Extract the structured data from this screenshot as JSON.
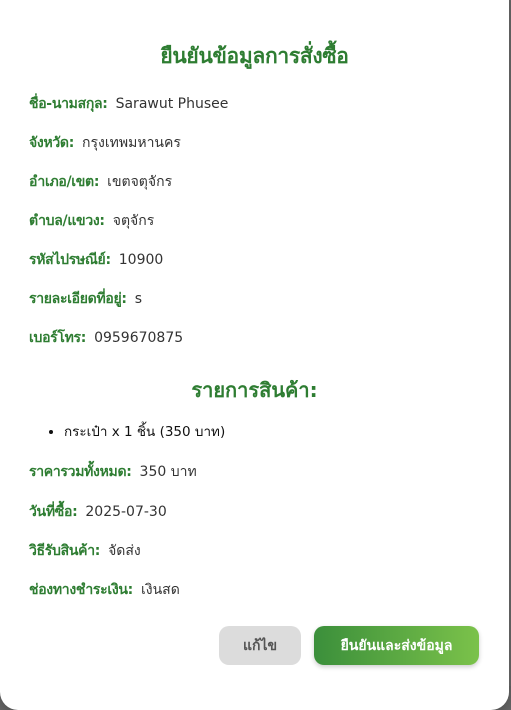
{
  "modal": {
    "title": "ยืนยันข้อมูลการสั่งซื้อ",
    "customer": [
      {
        "label": "ชื่อ-นามสกุล:",
        "value": "Sarawut Phusee"
      },
      {
        "label": "จังหวัด:",
        "value": "กรุงเทพมหานคร"
      },
      {
        "label": "อำเภอ/เขต:",
        "value": "เขตจตุจักร"
      },
      {
        "label": "ตำบล/แขวง:",
        "value": "จตุจักร"
      },
      {
        "label": "รหัสไปรษณีย์:",
        "value": "10900"
      },
      {
        "label": "รายละเอียดที่อยู่:",
        "value": "s"
      },
      {
        "label": "เบอร์โทร:",
        "value": "0959670875"
      }
    ],
    "items_title": "รายการสินค้า:",
    "items": [
      "กระเป๋า x 1 ชิ้น (350 บาท)"
    ],
    "summary": [
      {
        "label": "ราคารวมทั้งหมด:",
        "value": "350 บาท"
      },
      {
        "label": "วันที่ซื้อ:",
        "value": "2025-07-30"
      },
      {
        "label": "วิธีรับสินค้า:",
        "value": "จัดส่ง"
      },
      {
        "label": "ช่องทางชำระเงิน:",
        "value": "เงินสด"
      }
    ],
    "edit_label": "แก้ไข",
    "confirm_label": "ยืนยันและส่งข้อมูล"
  },
  "colors": {
    "accent": "#2e7d32",
    "confirm_start": "#3b8f3b",
    "confirm_end": "#7bc24a",
    "edit_bg": "#dcdcdc"
  }
}
